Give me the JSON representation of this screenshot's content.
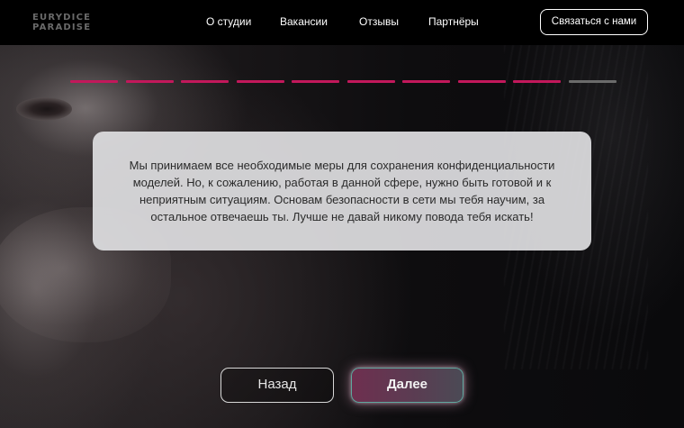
{
  "brand": {
    "logo_line1": "EURYDICE",
    "logo_line2": "PARADISE"
  },
  "nav": {
    "items": [
      {
        "label": "О студии"
      },
      {
        "label": "Вакансии"
      },
      {
        "label": "Отзывы"
      },
      {
        "label": "Партнёры"
      }
    ],
    "contact_label": "Связаться с нами"
  },
  "progress": {
    "total_steps": 10,
    "completed_steps": 9,
    "active_color": "#c2185b",
    "inactive_color": "#6b6b6b"
  },
  "card": {
    "text": "Мы принимаем все необходимые меры для сохранения конфиденциальности моделей. Но, к сожалению, работая в данной сфере, нужно быть готовой и к неприятным ситуациям. Основам безопасности в сети мы тебя научим, за остальное отвечаешь ты. Лучше не давай никому повода тебя искать!"
  },
  "actions": {
    "back_label": "Назад",
    "next_label": "Далее"
  },
  "colors": {
    "header_bg": "#000000",
    "accent": "#c2185b",
    "card_bg": "#dedee0",
    "next_border": "#5fa79e"
  }
}
